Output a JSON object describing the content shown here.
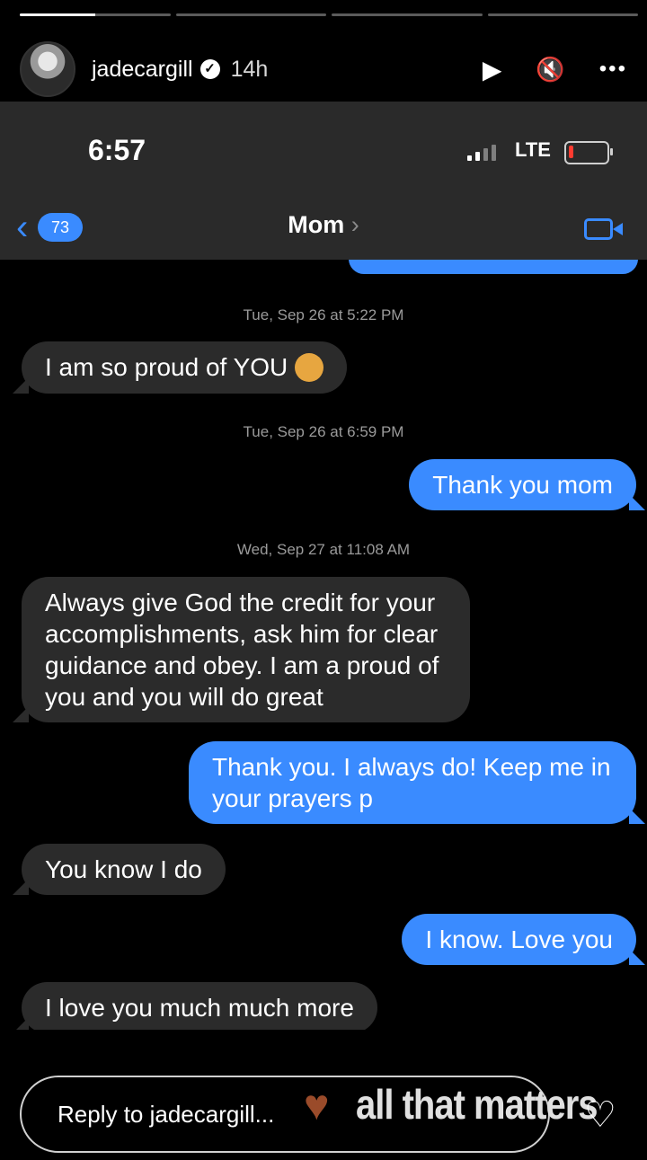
{
  "story": {
    "username": "jadecargill",
    "time_ago": "14h",
    "verified_icon": "verified-check-icon",
    "progress": [
      1,
      0,
      0,
      0
    ],
    "progress_current": 0.5,
    "icons": {
      "play": "▶",
      "mute": "🔇",
      "more": "•••"
    }
  },
  "status_bar": {
    "time": "6:57",
    "network": "LTE",
    "battery_level": 0.1
  },
  "thread": {
    "back_count": "73",
    "back_chevron": "‹",
    "contact_name": "Mom",
    "contact_chevron": "›"
  },
  "messages": [
    {
      "type": "stamp",
      "text": "Tue, Sep 26 at 5:22 PM"
    },
    {
      "type": "received",
      "text": "I am so proud of YOU",
      "emoji": "kissing-face"
    },
    {
      "type": "stamp",
      "text": "Tue, Sep 26 at 6:59 PM"
    },
    {
      "type": "sent",
      "text": "Thank you mom"
    },
    {
      "type": "stamp",
      "text": "Wed, Sep 27 at 11:08 AM"
    },
    {
      "type": "received",
      "text": "Always give God the credit for your accomplishments, ask him for clear guidance and obey. I am a proud of you and you will do great"
    },
    {
      "type": "sent",
      "text": "Thank you. I always do! Keep me in your prayers p"
    },
    {
      "type": "received",
      "text": "You know I do"
    },
    {
      "type": "sent",
      "text": "I know. Love you"
    },
    {
      "type": "received",
      "text": "I love you much much more"
    }
  ],
  "reply": {
    "placeholder": "Reply to jadecargill...",
    "sticker_text": "all that matters",
    "like_icon": "♡",
    "heart_sticker": "♥"
  },
  "colors": {
    "accent": "#3a8bff",
    "received_bubble": "#2b2b2b",
    "nav_bg": "#2a2a2a"
  }
}
